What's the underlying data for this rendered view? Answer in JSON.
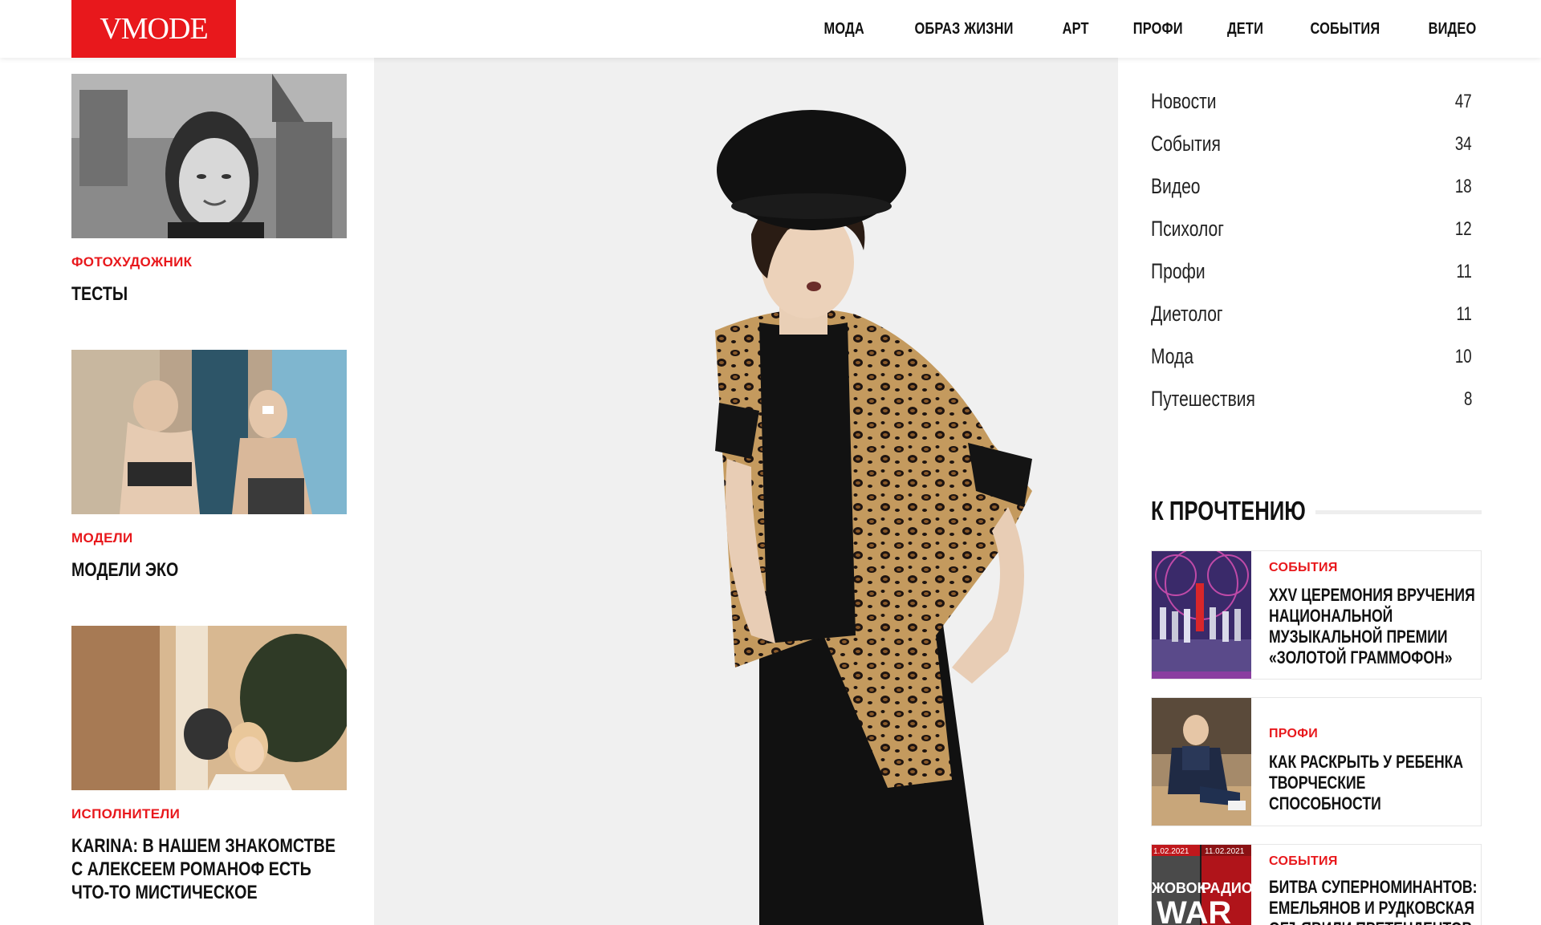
{
  "header": {
    "logo": "VMODE",
    "nav": [
      "МОДА",
      "ОБРАЗ ЖИЗНИ",
      "АРТ",
      "ПРОФИ",
      "ДЕТИ",
      "СОБЫТИЯ",
      "ВИДЕО"
    ]
  },
  "left_articles": [
    {
      "category": "ФОТОХУДОЖНИК",
      "title": "ТЕСТЫ"
    },
    {
      "category": "МОДЕЛИ",
      "title": "МОДЕЛИ ЭКО"
    },
    {
      "category": "ИСПОЛНИТЕЛИ",
      "title": "KARINA: В НАШЕМ ЗНАКОМСТВЕ С АЛЕКСЕЕМ РОМАНОФ ЕСТЬ ЧТО-ТО МИСТИЧЕСКОЕ"
    }
  ],
  "categories": [
    {
      "name": "Новости",
      "count": "47"
    },
    {
      "name": "События",
      "count": "34"
    },
    {
      "name": "Видео",
      "count": "18"
    },
    {
      "name": "Психолог",
      "count": "12"
    },
    {
      "name": "Профи",
      "count": "11"
    },
    {
      "name": "Диетолог",
      "count": "11"
    },
    {
      "name": "Мода",
      "count": "10"
    },
    {
      "name": "Путешествия",
      "count": "8"
    }
  ],
  "to_read": {
    "heading": "К ПРОЧТЕНИЮ",
    "items": [
      {
        "category": "СОБЫТИЯ",
        "title": "XXV ЦЕРЕМОНИЯ ВРУЧЕНИЯ НАЦИОНАЛЬНОЙ МУЗЫКАЛЬНОЙ ПРЕМИИ «ЗОЛОТОЙ ГРАММОФОН»"
      },
      {
        "category": "ПРОФИ",
        "title": "КАК РАСКРЫТЬ У РЕБЕНКА ТВОРЧЕСКИЕ СПОСОБНОСТИ"
      },
      {
        "category": "СОБЫТИЯ",
        "title": "БИТВА СУПЕРНОМИНАНТОВ: ЕМЕЛЬЯНОВ И РУДКОВСКАЯ ОБЪЯВИЛИ ПРЕТЕНДЕНТОВ НА"
      }
    ],
    "thumb3_dates": [
      "1.02.2021",
      "11.02.2021"
    ],
    "thumb3_text": [
      "ЖОВОК",
      "РАДИО",
      "WAR"
    ]
  },
  "colors": {
    "accent": "#e8181c",
    "text": "#111111",
    "hero_bg": "#f1f1f1"
  }
}
